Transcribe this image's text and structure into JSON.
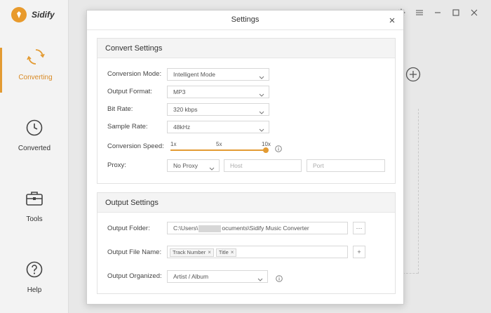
{
  "app": {
    "name": "Sidify",
    "nav": [
      {
        "label": "Converting",
        "icon": "sync-icon",
        "active": true
      },
      {
        "label": "Converted",
        "icon": "clock-icon",
        "active": false
      },
      {
        "label": "Tools",
        "icon": "toolbox-icon",
        "active": false
      },
      {
        "label": "Help",
        "icon": "help-icon",
        "active": false
      }
    ],
    "accent": "#e39b33"
  },
  "modal": {
    "title": "Settings",
    "convert": {
      "heading": "Convert Settings",
      "conversion_mode": {
        "label": "Conversion Mode:",
        "value": "Intelligent Mode"
      },
      "output_format": {
        "label": "Output Format:",
        "value": "MP3"
      },
      "bit_rate": {
        "label": "Bit Rate:",
        "value": "320 kbps"
      },
      "sample_rate": {
        "label": "Sample Rate:",
        "value": "48kHz"
      },
      "conversion_speed": {
        "label": "Conversion Speed:",
        "ticks": [
          "1x",
          "5x",
          "10x"
        ],
        "value": "10x"
      },
      "proxy": {
        "label": "Proxy:",
        "value": "No Proxy",
        "host_placeholder": "Host",
        "port_placeholder": "Port"
      }
    },
    "output": {
      "heading": "Output Settings",
      "folder": {
        "label": "Output Folder:",
        "prefix": "C:\\Users\\",
        "suffix": "ocuments\\Sidify Music Converter",
        "browse": "···"
      },
      "file_name": {
        "label": "Output File Name:",
        "tags": [
          "Track Number",
          "Title"
        ],
        "add": "+"
      },
      "organized": {
        "label": "Output Organized:",
        "value": "Artist / Album"
      }
    }
  }
}
